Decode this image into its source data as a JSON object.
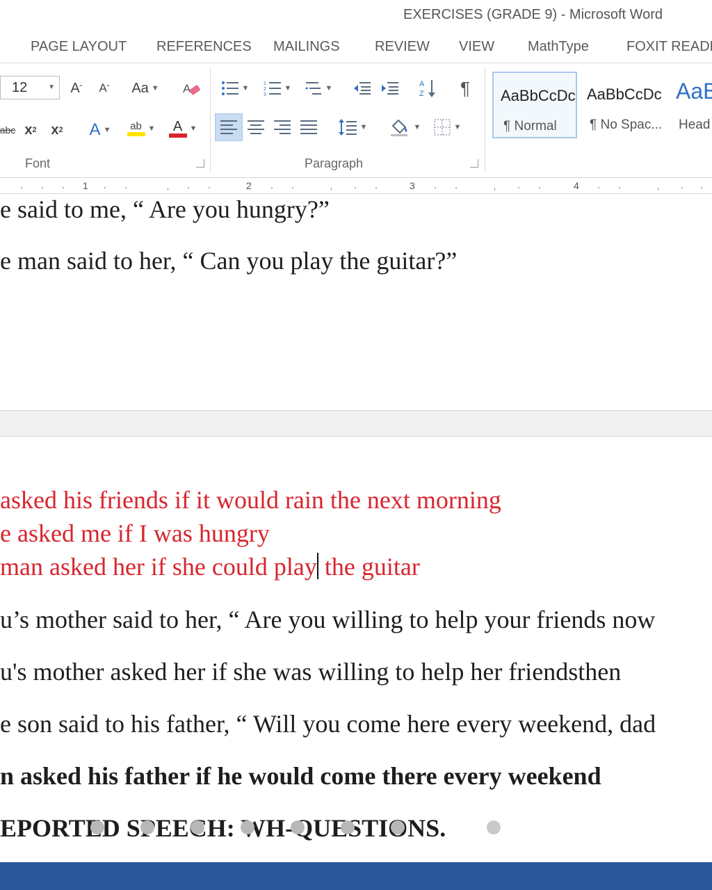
{
  "window": {
    "title": "EXERCISES (GRADE 9) - Microsoft Word"
  },
  "tabs": [
    "PAGE LAYOUT",
    "REFERENCES",
    "MAILINGS",
    "REVIEW",
    "VIEW",
    "MathType",
    "FOXIT READE"
  ],
  "ribbon": {
    "font": {
      "size": "12",
      "grow": "A",
      "shrink": "A",
      "change_case": "Aa",
      "strike": "abc",
      "subscript": "x",
      "subscript_mark": "2",
      "superscript": "x",
      "superscript_mark": "2",
      "text_effects": "A",
      "highlight": "ab",
      "font_color": "A",
      "label": "Font"
    },
    "paragraph": {
      "label": "Paragraph",
      "pilcrow": "¶"
    },
    "styles": [
      {
        "sample": "AaBbCcDc",
        "name": "¶ Normal"
      },
      {
        "sample": "AaBbCcDc",
        "name": "¶ No Spac..."
      },
      {
        "sample": "AaB",
        "name": "Head"
      }
    ],
    "colors": {
      "highlight": "#ffe400",
      "font_color": "#d8252e",
      "accent": "#2b579a"
    }
  },
  "ruler": {
    "marks": [
      "1",
      "2",
      "3",
      "4"
    ]
  },
  "document": {
    "lines": [
      "e said to me, “ Are you hungry?”",
      "e man said to her, “ Can you play the guitar?”",
      "asked his friends if it would rain the next morning",
      "e asked me if I was hungry",
      " man asked her if she could play",
      " the guitar",
      "u’s mother said to her, “ Are you willing to help your friends now",
      "u's mother asked her if she was willing to help her friendsthen",
      "e son said to his father, “ Will you come here every weekend, dad",
      "n asked his father if he would come there every weekend",
      "EPORTED SPEECH: WH-QUESTIONS."
    ]
  }
}
